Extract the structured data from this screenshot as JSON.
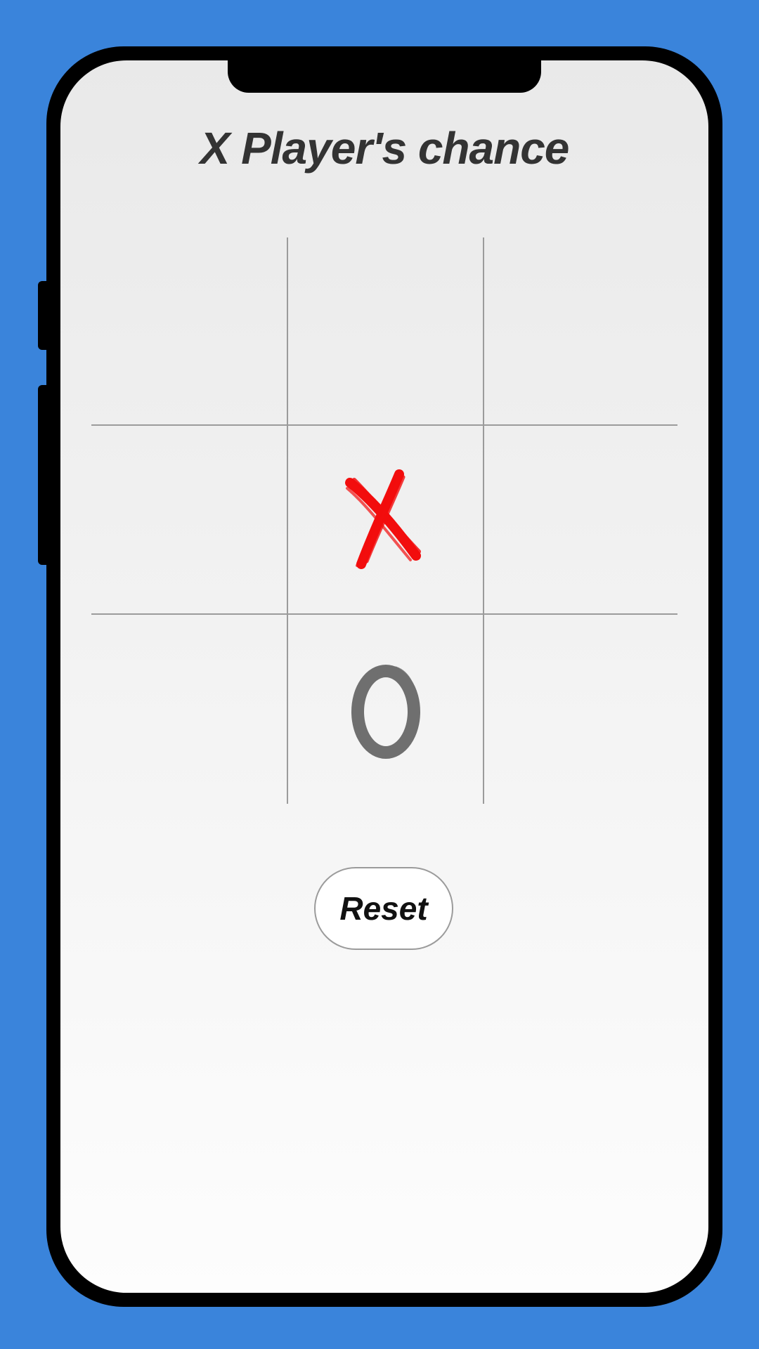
{
  "status": {
    "turn_text": "X Player's chance"
  },
  "board": {
    "cells": [
      "",
      "",
      "",
      "",
      "X",
      "",
      "",
      "O",
      ""
    ]
  },
  "controls": {
    "reset_label": "Reset"
  },
  "colors": {
    "background": "#3a84db",
    "x_mark": "#f20d0d",
    "o_mark": "#6f6f6f",
    "grid_line": "#9b9b9b"
  }
}
